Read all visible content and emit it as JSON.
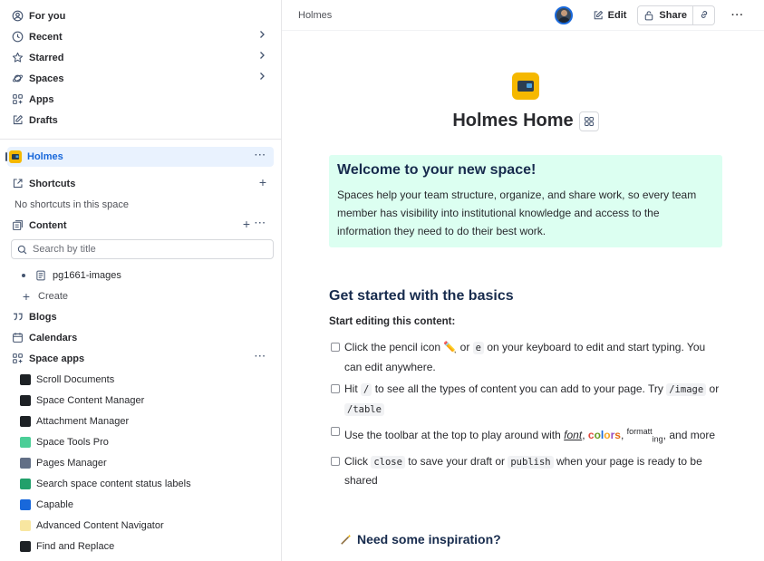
{
  "sidebar": {
    "nav": [
      {
        "label": "For you",
        "icon": "user-circle-icon"
      },
      {
        "label": "Recent",
        "icon": "clock-icon"
      },
      {
        "label": "Starred",
        "icon": "star-icon"
      },
      {
        "label": "Spaces",
        "icon": "planet-icon"
      },
      {
        "label": "Apps",
        "icon": "apps-icon"
      },
      {
        "label": "Drafts",
        "icon": "edit-icon"
      }
    ],
    "space_name": "Holmes",
    "shortcuts_label": "Shortcuts",
    "no_shortcuts": "No shortcuts in this space",
    "content_label": "Content",
    "search_placeholder": "Search by title",
    "page_item": "pg1661-images",
    "create_label": "Create",
    "blogs_label": "Blogs",
    "calendars_label": "Calendars",
    "space_apps_label": "Space apps",
    "apps": [
      {
        "label": "Scroll Documents",
        "color": "#1d2125"
      },
      {
        "label": "Space Content Manager",
        "color": "#1d2125"
      },
      {
        "label": "Attachment Manager",
        "color": "#1d2125"
      },
      {
        "label": "Space Tools Pro",
        "color": "#4bce97"
      },
      {
        "label": "Pages Manager",
        "color": "#626f86"
      },
      {
        "label": "Search space content status labels",
        "color": "#22a06b"
      },
      {
        "label": "Capable",
        "color": "#1868db"
      },
      {
        "label": "Advanced Content Navigator",
        "color": "#f8e6a0"
      },
      {
        "label": "Find and Replace",
        "color": "#1d2125"
      }
    ]
  },
  "header": {
    "breadcrumb": "Holmes",
    "edit_label": "Edit",
    "share_label": "Share"
  },
  "page": {
    "title": "Holmes Home",
    "welcome_title": "Welcome to your new space!",
    "welcome_body": "Spaces help your team structure, organize, and share work, so every team member has visibility into institutional knowledge and access to the information they need to do their best work.",
    "basics_heading": "Get started with the basics",
    "start_editing": "Start editing this content:",
    "task1_a": "Click the pencil icon ✏️ or",
    "task1_code": "e",
    "task1_b": "on your keyboard to edit and start typing. You can edit anywhere.",
    "task2_a": "Hit",
    "task2_code1": "/",
    "task2_b": "to see all the types of content you can add to your page. Try",
    "task2_code2": "/image",
    "task2_c": "or",
    "task2_code3": "/table",
    "task3_a": "Use the toolbar at the top to play around with",
    "task3_font": "font",
    "task3_sep": ",",
    "task3_colors": "colors",
    "task3_fmt1": "formatt",
    "task3_fmt2": "ing",
    "task3_b": ", and more",
    "task4_a": "Click",
    "task4_code1": "close",
    "task4_b": "to save your draft or",
    "task4_code2": "publish",
    "task4_c": "when your page is ready to be shared",
    "inspiration": "Need some inspiration?"
  }
}
